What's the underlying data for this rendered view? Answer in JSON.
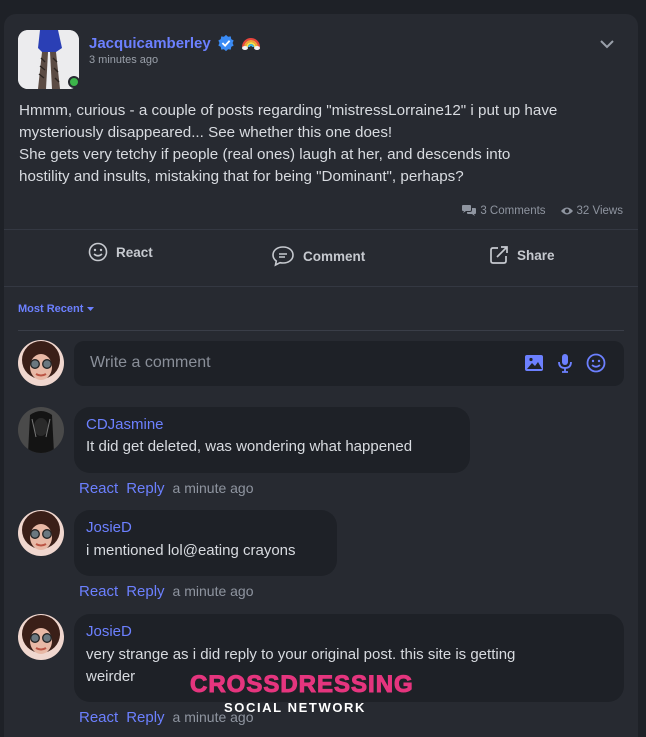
{
  "post": {
    "author": "Jacquicamberley",
    "time": "3 minutes ago",
    "text_lines": [
      "Hmmm, curious - a couple of posts regarding \"mistressLorraine12\" i put up have",
      "mysteriously disappeared... See whether this one does!",
      "She gets very tetchy if people (real ones) laugh at her, and descends into",
      "hostility and insults, mistaking that for being \"Dominant\", perhaps?"
    ],
    "comments_count": "3 Comments",
    "views_count": "32 Views",
    "online_color": "#3cb54a",
    "accent_color": "#6c80ff"
  },
  "actions": {
    "react": "React",
    "comment": "Comment",
    "share": "Share"
  },
  "sort_label": "Most Recent",
  "comment_input": {
    "placeholder": "Write a comment",
    "icons": [
      "image-icon",
      "microphone-icon",
      "emoji-icon"
    ]
  },
  "comments": [
    {
      "author": "CDJasmine",
      "text_lines": [
        "It did get deleted, was wondering what happened"
      ],
      "react": "React",
      "reply": "Reply",
      "time": "a minute ago"
    },
    {
      "author": "JosieD",
      "text_lines": [
        "i mentioned lol@eating crayons"
      ],
      "react": "React",
      "reply": "Reply",
      "time": "a minute ago"
    },
    {
      "author": "JosieD",
      "text_lines": [
        "very strange as i did reply to your original post. this site is getting",
        "weirder"
      ],
      "react": "React",
      "reply": "Reply",
      "time": "a minute ago"
    }
  ],
  "watermark": {
    "title": "CROSSDRESSING",
    "subtitle": "SOCIAL NETWORK",
    "color": "#e5357e"
  }
}
